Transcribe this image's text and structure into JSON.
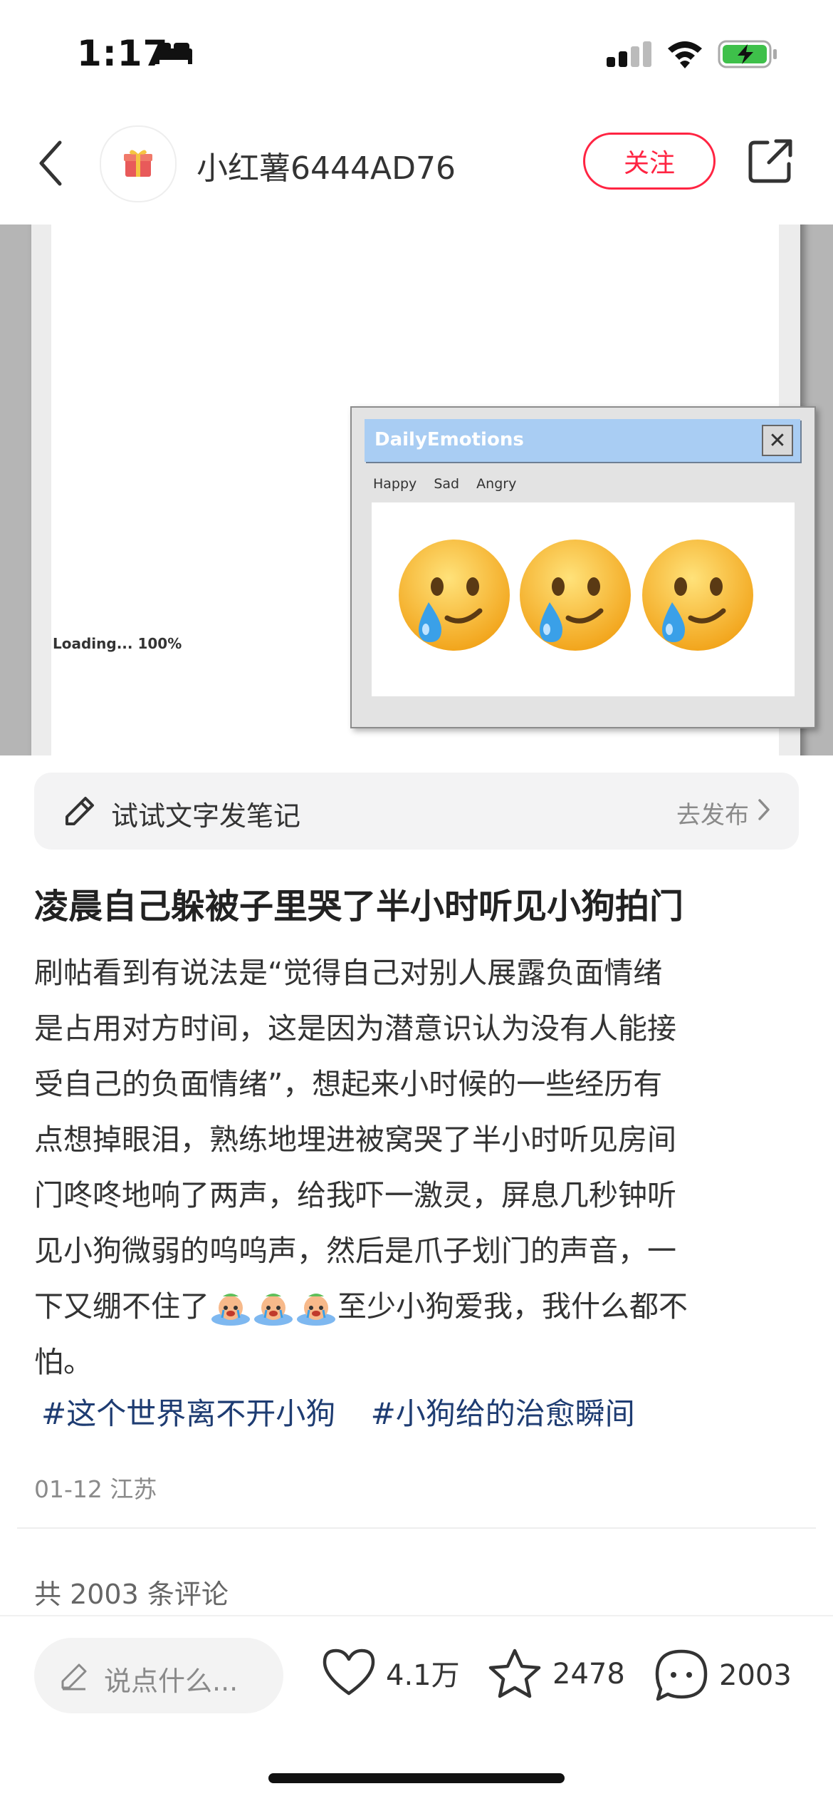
{
  "status_bar": {
    "time": "1:17"
  },
  "header": {
    "username": "小红薯6444AD76",
    "follow_label": "关注"
  },
  "image": {
    "loading_text": "Loading... 100%",
    "popup": {
      "title": "DailyEmotions",
      "close_glyph": "✕",
      "menu": [
        "Happy",
        "Sad",
        "Angry"
      ],
      "emoji": "crying-face-icon"
    }
  },
  "compose": {
    "label": "试试文字发笔记",
    "action": "去发布"
  },
  "post": {
    "title": "凌晨自己躲被子里哭了半小时听见小狗拍门",
    "lines": [
      "刷帖看到有说法是“觉得自己对别人展露负面情绪",
      "是占用对方时间，这是因为潜意识认为没有人能接",
      "受自己的负面情绪”，想起来小时候的一些经历有",
      "点想掉眼泪，熟练地埋进被窝哭了半小时听见房间",
      "门咚咚地响了两声，给我吓一激灵，屏息几秒钟听",
      "见小狗微弱的呜呜声，然后是爪子划门的声音，一"
    ],
    "line7_before": "下又绷不住了",
    "line7_after": "至少小狗爱我，我什么都不",
    "line8": "怕。",
    "tags": [
      "#这个世界离不开小狗",
      "#小狗给的治愈瞬间"
    ],
    "meta": "01-12 江苏",
    "comment_count": "共 2003 条评论"
  },
  "bottom_bar": {
    "placeholder": "说点什么...",
    "likes": "4.1万",
    "collects": "2478",
    "comments": "2003"
  },
  "colors": {
    "accent": "#ff2442",
    "tag": "#1e3c72",
    "popup_title": "#a9cdf3"
  }
}
